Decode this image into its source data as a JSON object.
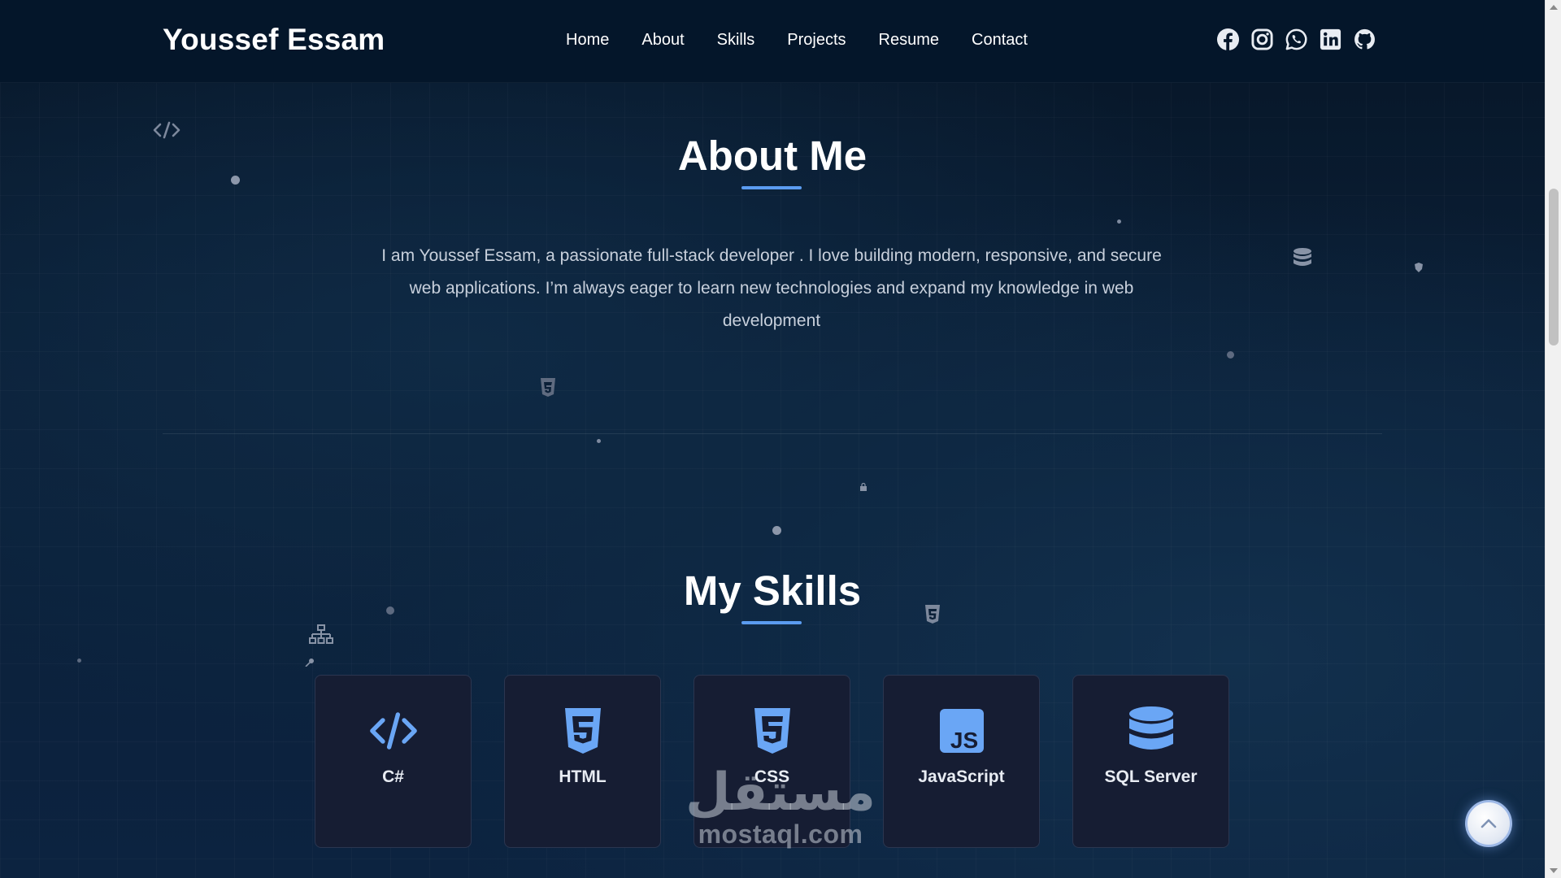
{
  "nav": {
    "brand": "Youssef Essam",
    "links": [
      "Home",
      "About",
      "Skills",
      "Projects",
      "Resume",
      "Contact"
    ],
    "socials": [
      "facebook-icon",
      "instagram-icon",
      "whatsapp-icon",
      "linkedin-icon",
      "github-icon"
    ]
  },
  "about": {
    "title": "About Me",
    "text": "I am Youssef Essam, a passionate full-stack developer . I love building modern, responsive, and secure web applications. I’m always eager to learn new technologies and expand my knowledge in web development"
  },
  "skills": {
    "title": "My Skills",
    "items": [
      {
        "name": "C#",
        "icon": "code-icon"
      },
      {
        "name": "HTML",
        "icon": "html5-icon"
      },
      {
        "name": "CSS",
        "icon": "css3-icon"
      },
      {
        "name": "JavaScript",
        "icon": "js-icon"
      },
      {
        "name": "SQL Server",
        "icon": "database-icon"
      }
    ]
  },
  "watermark": {
    "arabic": "مستقل",
    "latin": "mostaql.com"
  },
  "colors": {
    "accent": "#5b9cf0",
    "nav_bg": "#04162a",
    "card_bg": "#161d33",
    "page_bg": "#0b2038"
  }
}
